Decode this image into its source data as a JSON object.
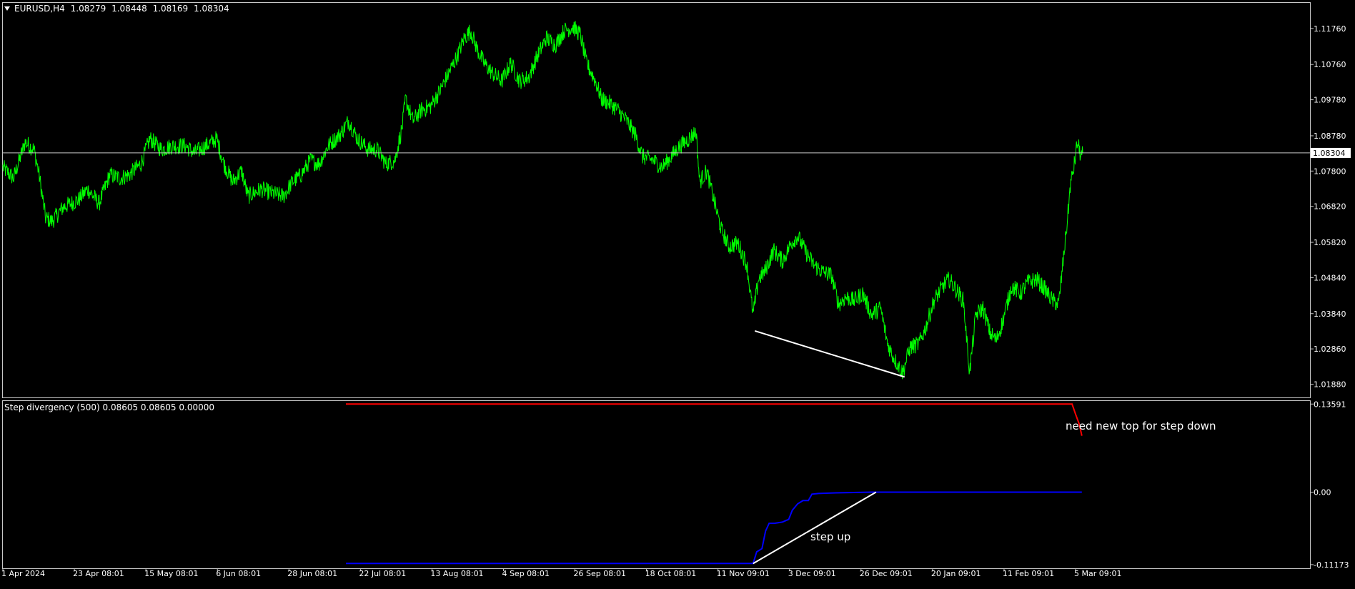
{
  "colors": {
    "background": "#000000",
    "frame": "#c8c8c8",
    "price": "#00ff00",
    "current_line": "#c8c8c8",
    "red_line": "#ff0000",
    "blue_line": "#0000ff",
    "annotation": "#ffffff",
    "text": "#ffffff",
    "price_tag_bg": "#ffffff",
    "price_tag_text": "#000000"
  },
  "icons": {
    "symbol_menu": "triangle-down-icon"
  },
  "chart_data": [
    {
      "type": "line",
      "header": {
        "symbol": "EURUSD,H4",
        "open": "1.08279",
        "high": "1.08448",
        "low": "1.08169",
        "close": "1.08304"
      },
      "current_price": 1.08304,
      "current_price_label": "1.08304",
      "ylim": [
        1.01512,
        1.12472
      ],
      "y_ticks": [
        "1.11760",
        "1.10760",
        "1.09780",
        "1.08780",
        "1.07800",
        "1.06820",
        "1.05820",
        "1.04840",
        "1.03840",
        "1.02860",
        "1.01880"
      ],
      "x_ticks": [
        "1 Apr 2024",
        "23 Apr 08:01",
        "15 May 08:01",
        "6 Jun 08:01",
        "28 Jun 08:01",
        "22 Jul 08:01",
        "13 Aug 08:01",
        "4 Sep 08:01",
        "26 Sep 08:01",
        "18 Oct 08:01",
        "11 Nov 09:01",
        "3 Dec 09:01",
        "26 Dec 09:01",
        "20 Jan 09:01",
        "11 Feb 09:01",
        "5 Mar 09:01"
      ],
      "x_domain": [
        0,
        1467
      ],
      "grid": false,
      "series": [
        {
          "values": [
            [
              0,
              1.079
            ],
            [
              12,
              1.076
            ],
            [
              25,
              1.086
            ],
            [
              35,
              1.084
            ],
            [
              40,
              1.078
            ],
            [
              48,
              1.065
            ],
            [
              55,
              1.064
            ],
            [
              68,
              1.068
            ],
            [
              85,
              1.07
            ],
            [
              95,
              1.073
            ],
            [
              108,
              1.069
            ],
            [
              120,
              1.077
            ],
            [
              132,
              1.076
            ],
            [
              142,
              1.077
            ],
            [
              155,
              1.08
            ],
            [
              165,
              1.087
            ],
            [
              178,
              1.084
            ],
            [
              190,
              1.085
            ],
            [
              205,
              1.085
            ],
            [
              215,
              1.083
            ],
            [
              228,
              1.085
            ],
            [
              240,
              1.087
            ],
            [
              248,
              1.08
            ],
            [
              258,
              1.075
            ],
            [
              268,
              1.078
            ],
            [
              275,
              1.071
            ],
            [
              290,
              1.073
            ],
            [
              300,
              1.072
            ],
            [
              315,
              1.071
            ],
            [
              325,
              1.075
            ],
            [
              335,
              1.077
            ],
            [
              345,
              1.081
            ],
            [
              355,
              1.08
            ],
            [
              365,
              1.085
            ],
            [
              378,
              1.088
            ],
            [
              388,
              1.092
            ],
            [
              398,
              1.087
            ],
            [
              410,
              1.084
            ],
            [
              420,
              1.084
            ],
            [
              430,
              1.08
            ],
            [
              440,
              1.081
            ],
            [
              448,
              1.09
            ],
            [
              452,
              1.098
            ],
            [
              460,
              1.092
            ],
            [
              470,
              1.095
            ],
            [
              480,
              1.096
            ],
            [
              490,
              1.1
            ],
            [
              500,
              1.105
            ],
            [
              510,
              1.11
            ],
            [
              518,
              1.115
            ],
            [
              525,
              1.117
            ],
            [
              532,
              1.112
            ],
            [
              540,
              1.108
            ],
            [
              550,
              1.105
            ],
            [
              560,
              1.103
            ],
            [
              570,
              1.108
            ],
            [
              580,
              1.103
            ],
            [
              590,
              1.104
            ],
            [
              600,
              1.11
            ],
            [
              610,
              1.115
            ],
            [
              620,
              1.113
            ],
            [
              630,
              1.117
            ],
            [
              640,
              1.118
            ],
            [
              648,
              1.116
            ],
            [
              655,
              1.108
            ],
            [
              665,
              1.103
            ],
            [
              672,
              1.098
            ],
            [
              680,
              1.097
            ],
            [
              690,
              1.095
            ],
            [
              700,
              1.092
            ],
            [
              710,
              1.088
            ],
            [
              718,
              1.082
            ],
            [
              730,
              1.081
            ],
            [
              740,
              1.079
            ],
            [
              750,
              1.082
            ],
            [
              760,
              1.085
            ],
            [
              770,
              1.087
            ],
            [
              778,
              1.089
            ],
            [
              782,
              1.075
            ],
            [
              790,
              1.078
            ],
            [
              798,
              1.07
            ],
            [
              806,
              1.062
            ],
            [
              815,
              1.057
            ],
            [
              825,
              1.058
            ],
            [
              835,
              1.052
            ],
            [
              842,
              1.038
            ],
            [
              848,
              1.048
            ],
            [
              855,
              1.05
            ],
            [
              865,
              1.056
            ],
            [
              875,
              1.053
            ],
            [
              885,
              1.058
            ],
            [
              892,
              1.06
            ],
            [
              900,
              1.056
            ],
            [
              910,
              1.052
            ],
            [
              920,
              1.05
            ],
            [
              930,
              1.049
            ],
            [
              938,
              1.041
            ],
            [
              946,
              1.043
            ],
            [
              955,
              1.042
            ],
            [
              965,
              1.044
            ],
            [
              975,
              1.038
            ],
            [
              985,
              1.04
            ],
            [
              993,
              1.03
            ],
            [
              1000,
              1.026
            ],
            [
              1010,
              1.022
            ],
            [
              1018,
              1.029
            ],
            [
              1028,
              1.03
            ],
            [
              1035,
              1.034
            ],
            [
              1045,
              1.042
            ],
            [
              1055,
              1.046
            ],
            [
              1062,
              1.048
            ],
            [
              1070,
              1.045
            ],
            [
              1078,
              1.042
            ],
            [
              1085,
              1.022
            ],
            [
              1092,
              1.038
            ],
            [
              1100,
              1.04
            ],
            [
              1108,
              1.033
            ],
            [
              1115,
              1.031
            ],
            [
              1122,
              1.036
            ],
            [
              1132,
              1.046
            ],
            [
              1142,
              1.044
            ],
            [
              1150,
              1.047
            ],
            [
              1160,
              1.048
            ],
            [
              1170,
              1.045
            ],
            [
              1178,
              1.042
            ],
            [
              1185,
              1.041
            ],
            [
              1190,
              1.053
            ],
            [
              1195,
              1.065
            ],
            [
              1198,
              1.074
            ],
            [
              1202,
              1.079
            ],
            [
              1206,
              1.086
            ],
            [
              1210,
              1.082
            ],
            [
              1212,
              1.083
            ]
          ]
        }
      ],
      "annotations": [
        {
          "type": "trendline",
          "from": [
            844,
            1.0336
          ],
          "to": [
            1012,
            1.0208
          ]
        }
      ]
    },
    {
      "type": "line",
      "header": "Step divergency (500) 0.08605 0.08605 0.00000",
      "ylim": [
        -0.11735,
        0.1406
      ],
      "y_ticks": [
        "0.13591",
        "0.00",
        "-0.11173"
      ],
      "grid": false,
      "series": [
        {
          "color": "#ff0000",
          "values": [
            [
              385,
              0.1359
            ],
            [
              1200,
              0.1359
            ],
            [
              1204,
              0.12
            ],
            [
              1208,
              0.105
            ],
            [
              1211,
              0.087
            ]
          ]
        },
        {
          "color": "#0000ff",
          "values": [
            [
              385,
              -0.11
            ],
            [
              842,
              -0.11
            ],
            [
              846,
              -0.092
            ],
            [
              852,
              -0.087
            ],
            [
              856,
              -0.06
            ],
            [
              860,
              -0.048
            ],
            [
              866,
              -0.048
            ],
            [
              875,
              -0.046
            ],
            [
              882,
              -0.042
            ],
            [
              886,
              -0.028
            ],
            [
              892,
              -0.018
            ],
            [
              898,
              -0.013
            ],
            [
              904,
              -0.013
            ],
            [
              908,
              -0.003
            ],
            [
              915,
              -0.002
            ],
            [
              935,
              -0.001
            ],
            [
              975,
              0.0
            ],
            [
              1211,
              0.0
            ]
          ]
        }
      ],
      "annotations": [
        {
          "type": "trendline",
          "from": [
            842,
            -0.11
          ],
          "to": [
            980,
            0.0
          ]
        },
        {
          "type": "text",
          "text": "need new top for step down"
        },
        {
          "type": "text",
          "text": "step up"
        }
      ]
    }
  ]
}
